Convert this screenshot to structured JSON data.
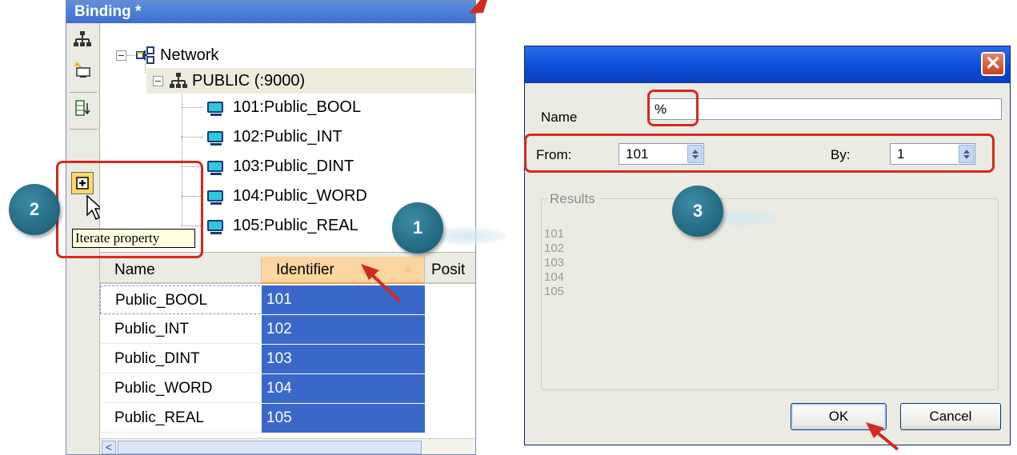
{
  "binding_panel": {
    "title": "Binding *",
    "tree": {
      "network_label": "Network",
      "public_label": "PUBLIC (:9000)",
      "variables": [
        "101:Public_BOOL",
        "102:Public_INT",
        "103:Public_DINT",
        "104:Public_WORD",
        "105:Public_REAL"
      ]
    },
    "toolbar_icons": [
      "network-icon",
      "add-variable-icon",
      "sort-icon",
      "iterate-property-icon"
    ],
    "tooltip": "Iterate property",
    "grid": {
      "columns": [
        "Name",
        "Identifier",
        "Posit"
      ],
      "rows": [
        {
          "name": "Public_BOOL",
          "identifier": "101"
        },
        {
          "name": "Public_INT",
          "identifier": "102"
        },
        {
          "name": "Public_DINT",
          "identifier": "103"
        },
        {
          "name": "Public_WORD",
          "identifier": "104"
        },
        {
          "name": "Public_REAL",
          "identifier": "105"
        }
      ],
      "scrollbar_glyph": "<"
    }
  },
  "dialog": {
    "close_glyph": "✕",
    "name_label": "Name",
    "name_value": "%",
    "from_label": "From:",
    "from_value": "101",
    "by_label": "By:",
    "by_value": "1",
    "results_label": "Results",
    "results": [
      "101",
      "102",
      "103",
      "104",
      "105"
    ],
    "ok_label": "OK",
    "cancel_label": "Cancel"
  },
  "annotations": {
    "badges": [
      "1",
      "2",
      "3"
    ],
    "highlight_color": "#d22a1f",
    "badge_color": "#20667f"
  }
}
